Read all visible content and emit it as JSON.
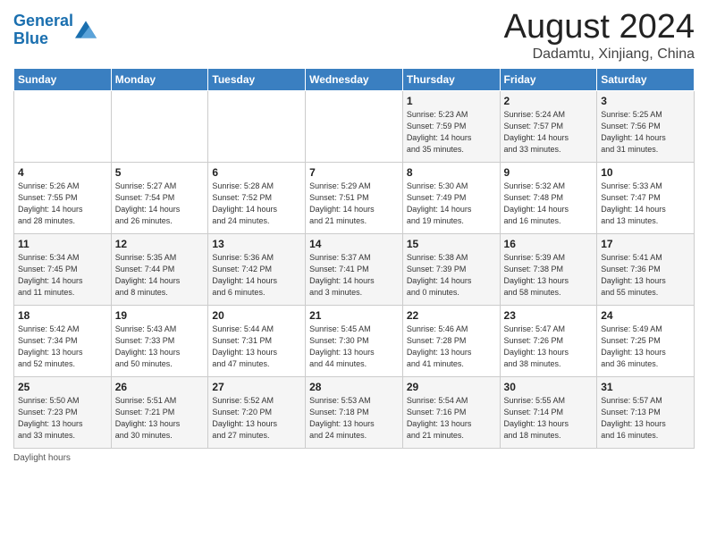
{
  "header": {
    "logo_line1": "General",
    "logo_line2": "Blue",
    "month_title": "August 2024",
    "subtitle": "Dadamtu, Xinjiang, China"
  },
  "days_of_week": [
    "Sunday",
    "Monday",
    "Tuesday",
    "Wednesday",
    "Thursday",
    "Friday",
    "Saturday"
  ],
  "weeks": [
    [
      {
        "day": null,
        "info": null
      },
      {
        "day": null,
        "info": null
      },
      {
        "day": null,
        "info": null
      },
      {
        "day": null,
        "info": null
      },
      {
        "day": "1",
        "info": "Sunrise: 5:23 AM\nSunset: 7:59 PM\nDaylight: 14 hours\nand 35 minutes."
      },
      {
        "day": "2",
        "info": "Sunrise: 5:24 AM\nSunset: 7:57 PM\nDaylight: 14 hours\nand 33 minutes."
      },
      {
        "day": "3",
        "info": "Sunrise: 5:25 AM\nSunset: 7:56 PM\nDaylight: 14 hours\nand 31 minutes."
      }
    ],
    [
      {
        "day": "4",
        "info": "Sunrise: 5:26 AM\nSunset: 7:55 PM\nDaylight: 14 hours\nand 28 minutes."
      },
      {
        "day": "5",
        "info": "Sunrise: 5:27 AM\nSunset: 7:54 PM\nDaylight: 14 hours\nand 26 minutes."
      },
      {
        "day": "6",
        "info": "Sunrise: 5:28 AM\nSunset: 7:52 PM\nDaylight: 14 hours\nand 24 minutes."
      },
      {
        "day": "7",
        "info": "Sunrise: 5:29 AM\nSunset: 7:51 PM\nDaylight: 14 hours\nand 21 minutes."
      },
      {
        "day": "8",
        "info": "Sunrise: 5:30 AM\nSunset: 7:49 PM\nDaylight: 14 hours\nand 19 minutes."
      },
      {
        "day": "9",
        "info": "Sunrise: 5:32 AM\nSunset: 7:48 PM\nDaylight: 14 hours\nand 16 minutes."
      },
      {
        "day": "10",
        "info": "Sunrise: 5:33 AM\nSunset: 7:47 PM\nDaylight: 14 hours\nand 13 minutes."
      }
    ],
    [
      {
        "day": "11",
        "info": "Sunrise: 5:34 AM\nSunset: 7:45 PM\nDaylight: 14 hours\nand 11 minutes."
      },
      {
        "day": "12",
        "info": "Sunrise: 5:35 AM\nSunset: 7:44 PM\nDaylight: 14 hours\nand 8 minutes."
      },
      {
        "day": "13",
        "info": "Sunrise: 5:36 AM\nSunset: 7:42 PM\nDaylight: 14 hours\nand 6 minutes."
      },
      {
        "day": "14",
        "info": "Sunrise: 5:37 AM\nSunset: 7:41 PM\nDaylight: 14 hours\nand 3 minutes."
      },
      {
        "day": "15",
        "info": "Sunrise: 5:38 AM\nSunset: 7:39 PM\nDaylight: 14 hours\nand 0 minutes."
      },
      {
        "day": "16",
        "info": "Sunrise: 5:39 AM\nSunset: 7:38 PM\nDaylight: 13 hours\nand 58 minutes."
      },
      {
        "day": "17",
        "info": "Sunrise: 5:41 AM\nSunset: 7:36 PM\nDaylight: 13 hours\nand 55 minutes."
      }
    ],
    [
      {
        "day": "18",
        "info": "Sunrise: 5:42 AM\nSunset: 7:34 PM\nDaylight: 13 hours\nand 52 minutes."
      },
      {
        "day": "19",
        "info": "Sunrise: 5:43 AM\nSunset: 7:33 PM\nDaylight: 13 hours\nand 50 minutes."
      },
      {
        "day": "20",
        "info": "Sunrise: 5:44 AM\nSunset: 7:31 PM\nDaylight: 13 hours\nand 47 minutes."
      },
      {
        "day": "21",
        "info": "Sunrise: 5:45 AM\nSunset: 7:30 PM\nDaylight: 13 hours\nand 44 minutes."
      },
      {
        "day": "22",
        "info": "Sunrise: 5:46 AM\nSunset: 7:28 PM\nDaylight: 13 hours\nand 41 minutes."
      },
      {
        "day": "23",
        "info": "Sunrise: 5:47 AM\nSunset: 7:26 PM\nDaylight: 13 hours\nand 38 minutes."
      },
      {
        "day": "24",
        "info": "Sunrise: 5:49 AM\nSunset: 7:25 PM\nDaylight: 13 hours\nand 36 minutes."
      }
    ],
    [
      {
        "day": "25",
        "info": "Sunrise: 5:50 AM\nSunset: 7:23 PM\nDaylight: 13 hours\nand 33 minutes."
      },
      {
        "day": "26",
        "info": "Sunrise: 5:51 AM\nSunset: 7:21 PM\nDaylight: 13 hours\nand 30 minutes."
      },
      {
        "day": "27",
        "info": "Sunrise: 5:52 AM\nSunset: 7:20 PM\nDaylight: 13 hours\nand 27 minutes."
      },
      {
        "day": "28",
        "info": "Sunrise: 5:53 AM\nSunset: 7:18 PM\nDaylight: 13 hours\nand 24 minutes."
      },
      {
        "day": "29",
        "info": "Sunrise: 5:54 AM\nSunset: 7:16 PM\nDaylight: 13 hours\nand 21 minutes."
      },
      {
        "day": "30",
        "info": "Sunrise: 5:55 AM\nSunset: 7:14 PM\nDaylight: 13 hours\nand 18 minutes."
      },
      {
        "day": "31",
        "info": "Sunrise: 5:57 AM\nSunset: 7:13 PM\nDaylight: 13 hours\nand 16 minutes."
      }
    ]
  ],
  "footer": {
    "daylight_label": "Daylight hours"
  }
}
